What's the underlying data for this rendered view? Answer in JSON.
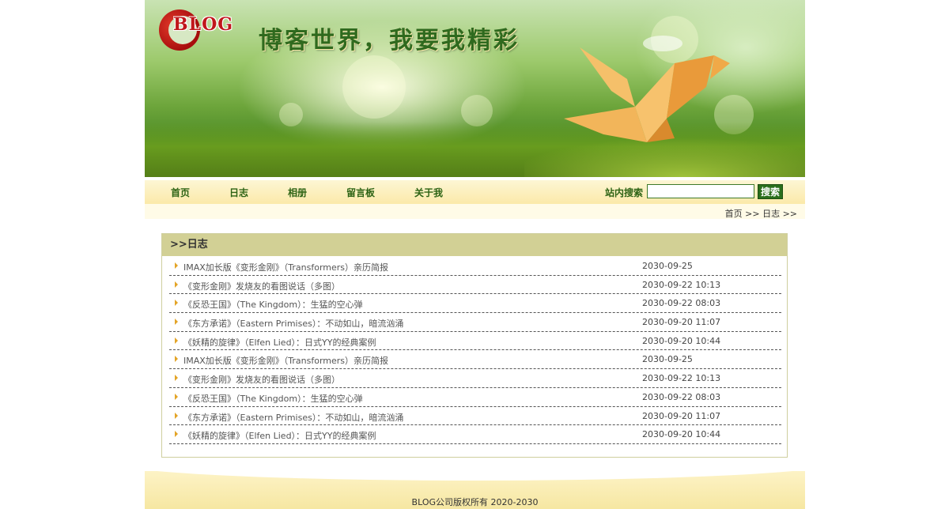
{
  "header": {
    "logo_text": "BLOG",
    "slogan": "博客世界，我要我精彩"
  },
  "nav": {
    "items": [
      {
        "label": "首页"
      },
      {
        "label": "日志"
      },
      {
        "label": "相册"
      },
      {
        "label": "留言板"
      },
      {
        "label": "关于我"
      }
    ],
    "search_label": "站内搜索",
    "search_value": "",
    "search_button": "搜索"
  },
  "breadcrumb": "首页 >> 日志 >>",
  "panel": {
    "title": ">>日志",
    "entries": [
      {
        "title": "IMAX加长版《变形金刚》（Transformers）亲历简报",
        "date": "2030-09-25"
      },
      {
        "title": "《变形金刚》发烧友的看图说话（多图）",
        "date": "2030-09-22 10:13"
      },
      {
        "title": "《反恐王国》（The Kingdom）：生猛的空心弹",
        "date": "2030-09-22 08:03"
      },
      {
        "title": "《东方承诺》（Eastern Primises）：不动如山，暗流汹涌",
        "date": "2030-09-20 11:07"
      },
      {
        "title": "《妖精的旋律》（Elfen Lied）：日式YY的经典案例",
        "date": "2030-09-20 10:44"
      },
      {
        "title": "IMAX加长版《变形金刚》（Transformers）亲历简报",
        "date": "2030-09-25"
      },
      {
        "title": "《变形金刚》发烧友的看图说话（多图）",
        "date": "2030-09-22 10:13"
      },
      {
        "title": "《反恐王国》（The Kingdom）：生猛的空心弹",
        "date": "2030-09-22 08:03"
      },
      {
        "title": "《东方承诺》（Eastern Primises）：不动如山，暗流汹涌",
        "date": "2030-09-20 11:07"
      },
      {
        "title": "《妖精的旋律》（Elfen Lied）：日式YY的经典案例",
        "date": "2030-09-20 10:44"
      }
    ]
  },
  "footer": {
    "copyright": "BLOG公司版权所有 2020-2030"
  },
  "colors": {
    "nav_text": "#2d6314",
    "panel_header": "#d2d095",
    "arrow": "#e3a427",
    "footer_bg": "#f6e7a2"
  }
}
